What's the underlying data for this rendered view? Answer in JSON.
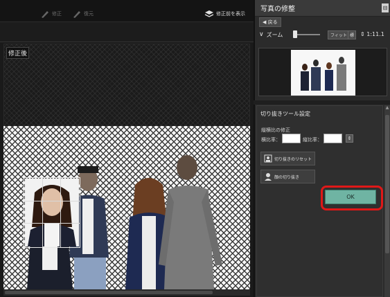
{
  "toolbar": {
    "undo_label": "修正",
    "redo_label": "復元",
    "show_before_label": "修正前を表示"
  },
  "canvas": {
    "after_label": "修正後"
  },
  "panel": {
    "title": "写真の修整",
    "back_label": "戻る",
    "zoom_label": "ズーム",
    "fit_label": "フィット",
    "ratio_label": "標",
    "zoom_value": "1:11.1"
  },
  "crop_tool": {
    "title": "切り抜きツール設定",
    "aspect_label": "縦横比の修正",
    "width_label": "横比率：",
    "height_label": "縦比率：",
    "width_value": "",
    "height_value": "",
    "reset_label": "切り抜きのリセット",
    "face_label": "顔の切り抜き",
    "ok_label": "OK"
  },
  "colors": {
    "ok_button": "#6fb4a3",
    "highlight": "#e01818",
    "panel_bg": "#2b2b2b"
  }
}
